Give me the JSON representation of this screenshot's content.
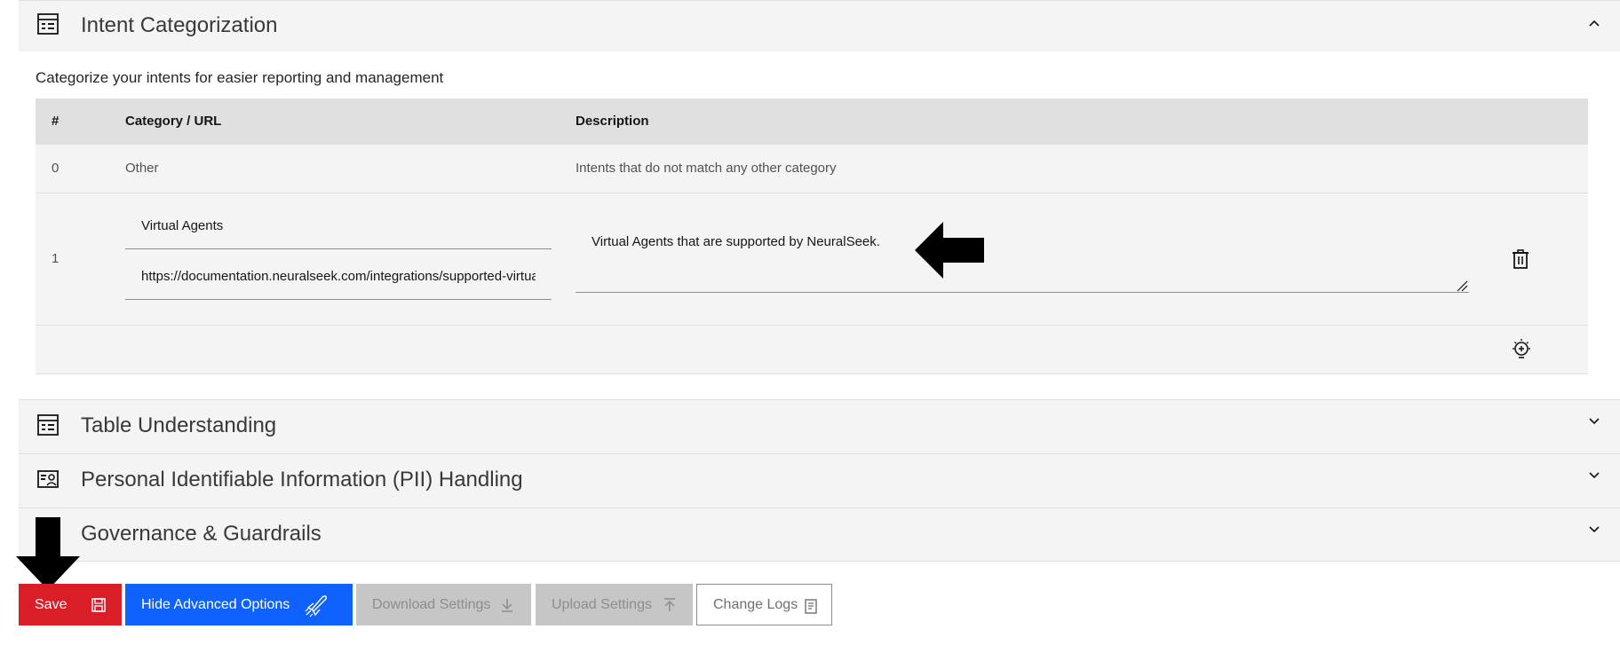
{
  "intent_section": {
    "title": "Intent Categorization",
    "description": "Categorize your intents for easier reporting and management",
    "table": {
      "headers": {
        "num": "#",
        "category": "Category / URL",
        "description": "Description"
      },
      "rows": [
        {
          "num": "0",
          "category": "Other",
          "description": "Intents that do not match any other category"
        },
        {
          "num": "1",
          "category_value": "Virtual Agents",
          "url_value": "https://documentation.neuralseek.com/integrations/supported-virtual-agents/",
          "description_value": "Virtual Agents that are supported by NeuralSeek."
        }
      ]
    }
  },
  "sections": [
    {
      "title": "Table Understanding"
    },
    {
      "title": "Personal Identifiable Information (PII) Handling"
    },
    {
      "title": "Governance & Guardrails"
    }
  ],
  "toolbar": {
    "save": "Save",
    "hide_advanced": "Hide Advanced Options",
    "download_settings": "Download Settings",
    "upload_settings": "Upload Settings",
    "change_logs": "Change Logs"
  },
  "colors": {
    "save": "#da1e28",
    "primary": "#0f62fe",
    "disabled": "#c6c6c6",
    "header_bg": "#f4f4f4",
    "table_header_bg": "#e0e0e0"
  },
  "icons": [
    "table-icon",
    "chevron-up-icon",
    "chevron-down-icon",
    "id-card-icon",
    "trash-icon",
    "lightbulb-add-icon",
    "save-icon",
    "rocket-icon",
    "download-icon",
    "upload-icon",
    "log-icon",
    "arrow-left-icon",
    "arrow-down-icon"
  ]
}
